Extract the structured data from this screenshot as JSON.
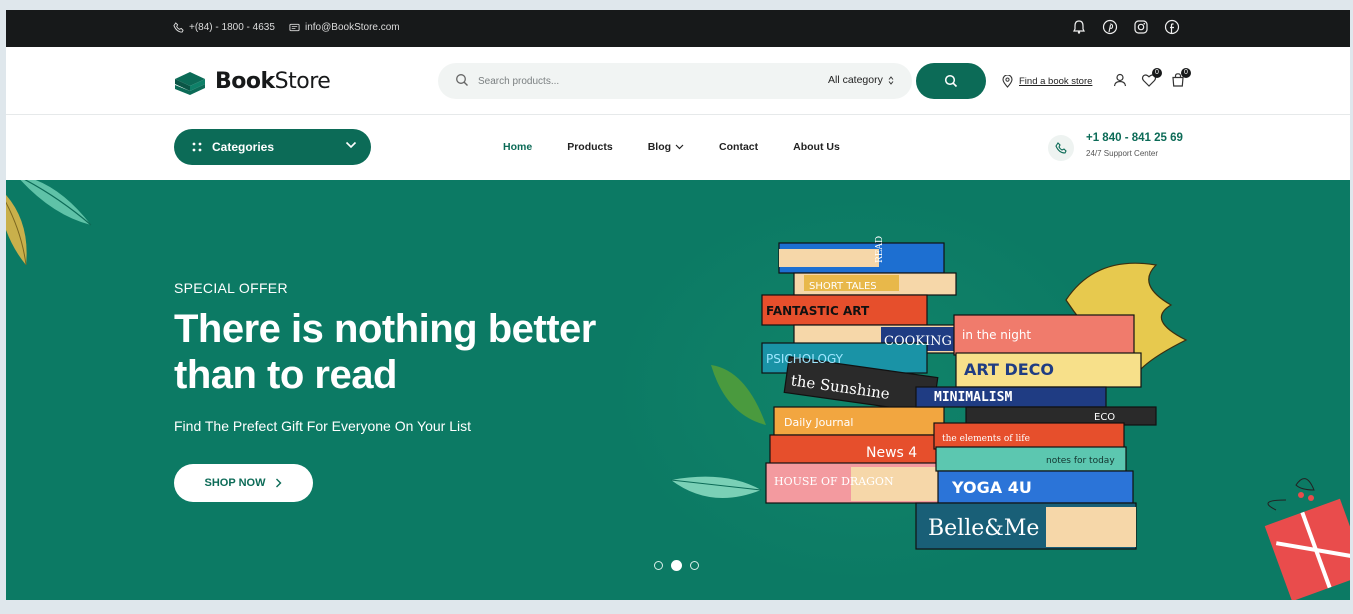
{
  "topbar": {
    "phone": "+(84) - 1800 - 4635",
    "email": "info@BookStore.com",
    "social_icons": [
      "bell-icon",
      "pinterest-icon",
      "instagram-icon",
      "facebook-icon"
    ]
  },
  "header": {
    "logo_bold": "Book",
    "logo_light": "Store",
    "search_placeholder": "Search products...",
    "category_select": "All category",
    "find_store": "Find a book store",
    "wishlist_count": "0",
    "cart_count": "0"
  },
  "nav": {
    "categories_label": "Categories",
    "items": [
      {
        "label": "Home",
        "active": true
      },
      {
        "label": "Products",
        "active": false
      },
      {
        "label": "Blog",
        "active": false,
        "dropdown": true
      },
      {
        "label": "Contact",
        "active": false
      },
      {
        "label": "About Us",
        "active": false
      }
    ],
    "phone_number": "+1 840 - 841 25 69",
    "phone_caption": "24/7 Support Center"
  },
  "hero": {
    "eyebrow": "SPECIAL OFFER",
    "headline": "There is nothing better than to read",
    "subline": "Find The Prefect Gift For Everyone On Your List",
    "button": "SHOP NOW",
    "slides": 3,
    "active_slide": 2,
    "book_spines": [
      "READ KING",
      "SHORT TALES",
      "FANTASTIC ART",
      "COOKING",
      "PSICHOLOGY",
      "the Sunshine",
      "Daily Journal",
      "News 4",
      "HOUSE OF DRAGON",
      "in the night",
      "ART DECO",
      "MINIMALISM",
      "ECO",
      "the elements of life",
      "notes for today",
      "YOGA 4U",
      "Belle&Me"
    ]
  },
  "colors": {
    "brand": "#0c6b57",
    "hero_bg": "#0c7a64",
    "topbar_bg": "#17191a"
  }
}
